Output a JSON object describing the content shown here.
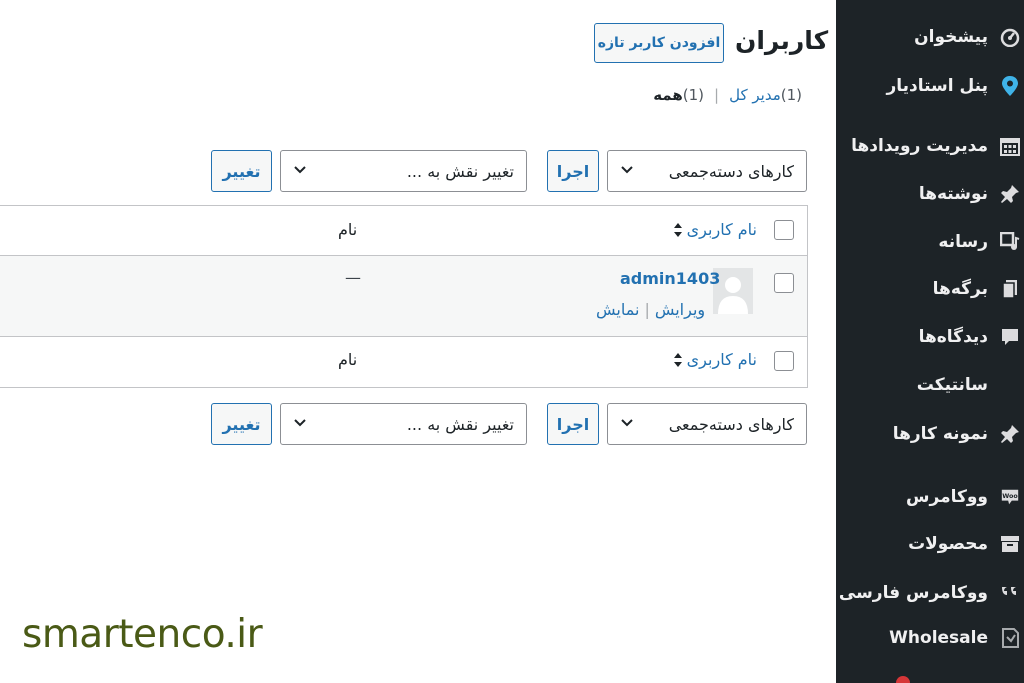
{
  "sidebar": {
    "items": [
      {
        "label": "پیشخوان",
        "icon": "dashboard-icon"
      },
      {
        "label": "پنل استادیار",
        "icon": "location-pin-icon"
      },
      {
        "label": "مدیریت رویدادها",
        "icon": "calendar-icon"
      },
      {
        "label": "نوشته‌ها",
        "icon": "pin-icon"
      },
      {
        "label": "رسانه",
        "icon": "media-icon"
      },
      {
        "label": "برگه‌ها",
        "icon": "pages-icon"
      },
      {
        "label": "دیدگاه‌ها",
        "icon": "comment-icon"
      },
      {
        "label": "سانتیکت",
        "icon": ""
      },
      {
        "label": "نمونه کارها",
        "icon": "pin-icon"
      },
      {
        "label": "ووکامرس",
        "icon": "woo-icon"
      },
      {
        "label": "محصولات",
        "icon": "archive-icon"
      },
      {
        "label": "ووکامرس فارسی",
        "icon": "quote-icon"
      },
      {
        "label": "Wholesale",
        "icon": "wholesale-icon"
      }
    ]
  },
  "header": {
    "title": "کاربران",
    "add_new_label": "افزودن کاربر تازه"
  },
  "filters": {
    "all_label": "همه",
    "all_count": "(1)",
    "separator": "|",
    "admin_label": "مدیر کل",
    "admin_count": "(1)"
  },
  "bulk": {
    "actions_value": "کارهای دسته‌جمعی",
    "apply_label": "اجرا",
    "role_value": "تغییر نقش به ...",
    "change_label": "تغییر"
  },
  "table": {
    "col_username": "نام کاربری",
    "col_name": "نام",
    "rows": [
      {
        "username": "admin1403",
        "name": "—",
        "actions": {
          "edit": "ویرایش",
          "separator": "|",
          "view": "نمایش"
        }
      }
    ]
  },
  "watermark": "smartenco.ir",
  "colors": {
    "sidebar_bg": "#1d2327",
    "accent": "#2271b1",
    "watermark": "#4a5a16"
  }
}
